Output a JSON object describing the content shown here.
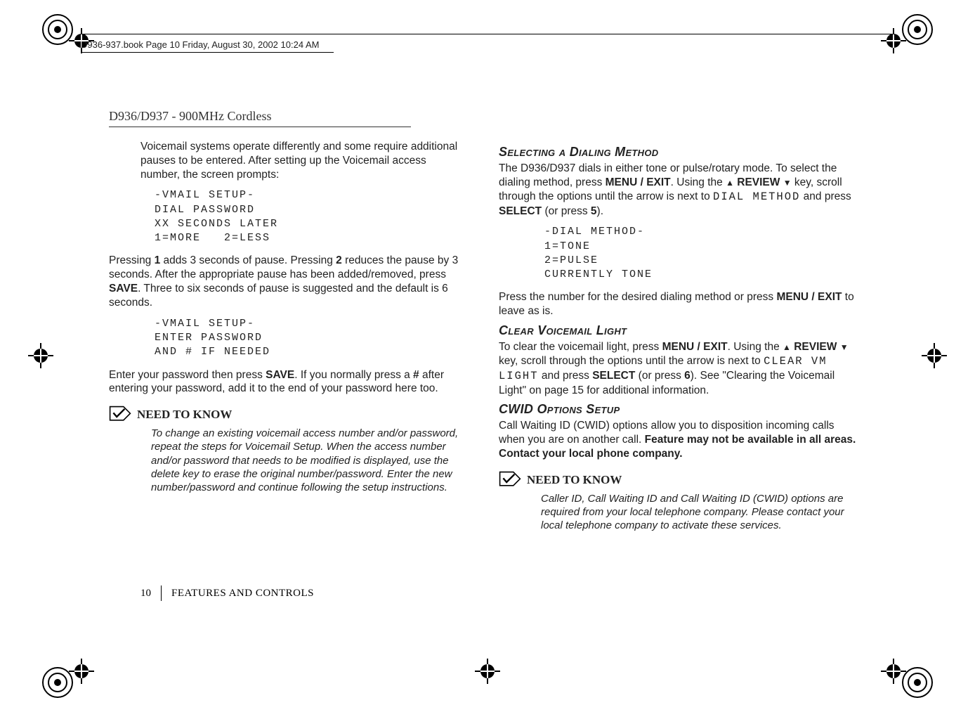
{
  "header_line": "D936-937.book  Page 10  Friday, August 30, 2002  10:24 AM",
  "model_title": "D936/D937 - 900MHz Cordless",
  "left": {
    "indent1": "Voicemail systems operate differently and some require additional pauses to be entered. After setting up the Voicemail access number, the screen prompts:",
    "mono1_l1": "-VMAIL SETUP-",
    "mono1_l2": "DIAL PASSWORD",
    "mono1_l3": "XX SECONDS LATER",
    "mono1_l4": "1=MORE   2=LESS",
    "p2_a": "Pressing ",
    "p2_b1": "1",
    "p2_c": " adds 3 seconds of pause. Pressing ",
    "p2_b2": "2",
    "p2_d": " reduces the pause by 3 seconds. After the appropriate pause has been added/removed, press ",
    "p2_b3": "SAVE",
    "p2_e": ". Three to six seconds of pause is suggested and the default is 6 seconds.",
    "mono2_l1": "-VMAIL SETUP-",
    "mono2_l2": "ENTER PASSWORD",
    "mono2_l3": "AND # IF NEEDED",
    "p3_a": "Enter your password then press ",
    "p3_b1": "SAVE",
    "p3_c": ". If you normally press a ",
    "p3_b2": "#",
    "p3_d": " after entering your password, add it to the end of your password here too.",
    "ntk_title": "NEED TO KNOW",
    "ntk_body": "To change an existing voicemail access number and/or password, repeat the steps for Voicemail Setup. When the access number and/or password that needs to be modified is displayed, use the delete key to erase the original number/password. Enter the new number/password and continue following the setup instructions."
  },
  "right": {
    "h1": "Selecting a Dialing Method",
    "p1_a": "The D936/D937 dials in either tone or pulse/rotary mode. To select the dialing method, press ",
    "p1_b1": "MENU / EXIT",
    "p1_c": ". Using the ",
    "p1_b2": " REVIEW ",
    "p1_d": " key, scroll through the options until the arrow is next to ",
    "p1_mono": "DIAL METHOD",
    "p1_e": " and press ",
    "p1_b3": "SELECT",
    "p1_f": " (or press ",
    "p1_b4": "5",
    "p1_g": ").",
    "mono3_l1": "-DIAL METHOD-",
    "mono3_l2": "1=TONE",
    "mono3_l3": "2=PULSE",
    "mono3_l4": "CURRENTLY TONE",
    "p2_a": "Press the number for the desired dialing method or press ",
    "p2_b1": "MENU / EXIT",
    "p2_c": " to leave as is.",
    "h2": "Clear Voicemail Light",
    "p3_a": "To clear the voicemail light, press ",
    "p3_b1": "MENU / EXIT",
    "p3_c": ". Using the ",
    "p3_b2": " REVIEW ",
    "p3_d": " key, scroll through the options until the arrow is next to ",
    "p3_mono": "CLEAR VM LIGHT",
    "p3_e": " and press ",
    "p3_b3": "SELECT",
    "p3_f": " (or press ",
    "p3_b4": "6",
    "p3_g": "). See \"Clearing the Voicemail Light\" on page 15 for additional information.",
    "h3": "CWID Options Setup",
    "p4_a": "Call Waiting ID (CWID) options allow you to disposition incoming calls when you are on another call. ",
    "p4_b": "Feature may not be available in all areas. Contact your local phone company.",
    "ntk_title": "NEED TO KNOW",
    "ntk_body": "Caller ID, Call Waiting ID and Call Waiting ID (CWID) options are required from your local telephone company. Please contact your local telephone company to activate these services."
  },
  "footer": {
    "page": "10",
    "section": "FEATURES AND CONTROLS"
  }
}
